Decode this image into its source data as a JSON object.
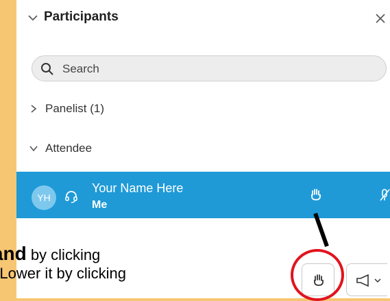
{
  "panel": {
    "title": "Participants",
    "close_label": "×"
  },
  "search": {
    "placeholder": "Search"
  },
  "groups": [
    {
      "label": "Panelist (1)",
      "expanded": false
    },
    {
      "label": "Attendee",
      "expanded": true
    }
  ],
  "attendee_row": {
    "initials": "YH",
    "name": "Your Name Here",
    "sub": "Me",
    "selected": true
  },
  "instruction": {
    "line1_bold": "e your hand",
    "line1_rest": " by clicking",
    "line2": "and icon. Lower it by clicking"
  },
  "colors": {
    "background": "#f7c673",
    "selected_row": "#1f9ad7",
    "highlight": "#e0141e"
  },
  "icons": {
    "header": "chevron-down-icon",
    "close": "close-icon",
    "search": "search-icon",
    "audio": "headset-icon",
    "raise_hand": "hand-icon",
    "mic": "mic-muted-icon",
    "reactions": "megaphone-icon"
  }
}
